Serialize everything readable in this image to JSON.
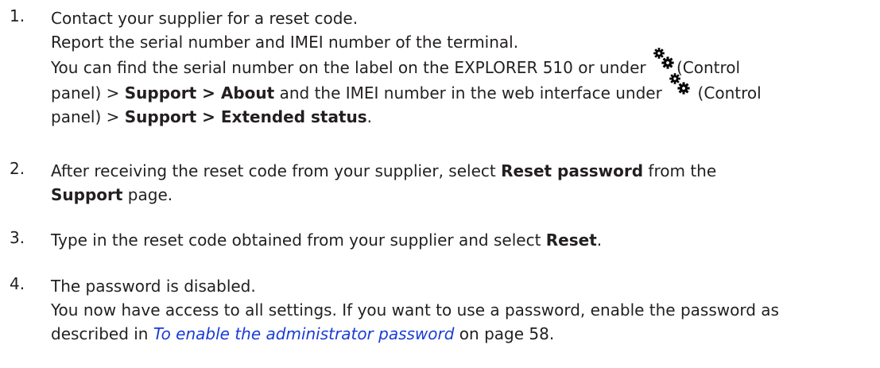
{
  "steps": [
    {
      "number": "1.",
      "lines": {
        "l1": "Contact your supplier for a reset code.",
        "l2": "Report the serial number and IMEI number of the terminal.",
        "l3a": "You can find the serial number on the label on the EXPLORER 510 or under ",
        "l3b": "(Control",
        "l4a": "panel) > ",
        "l4b": "Support > About",
        "l4c": " and the IMEI number in the web interface under ",
        "l4d": " (Control",
        "l5a": "panel) > ",
        "l5b": "Support > Extended status",
        "l5c": "."
      }
    },
    {
      "number": "2.",
      "lines": {
        "l1a": "After receiving the reset code from your supplier, select ",
        "l1b": "Reset password",
        "l1c": " from the",
        "l2a": "Support",
        "l2b": " page."
      }
    },
    {
      "number": "3.",
      "lines": {
        "l1a": "Type in the reset code obtained from your supplier and select ",
        "l1b": "Reset",
        "l1c": "."
      }
    },
    {
      "number": "4.",
      "lines": {
        "l1": "The password is disabled.",
        "l2": "You now have access to all settings. If you want to use a password, enable the password as",
        "l3a": "described in ",
        "l3b": "To enable the administrator password",
        "l3c": " on page 58."
      }
    }
  ],
  "icons": {
    "control_panel": "gears-icon"
  },
  "colors": {
    "text": "#231f20",
    "link": "#1a3cd6"
  }
}
